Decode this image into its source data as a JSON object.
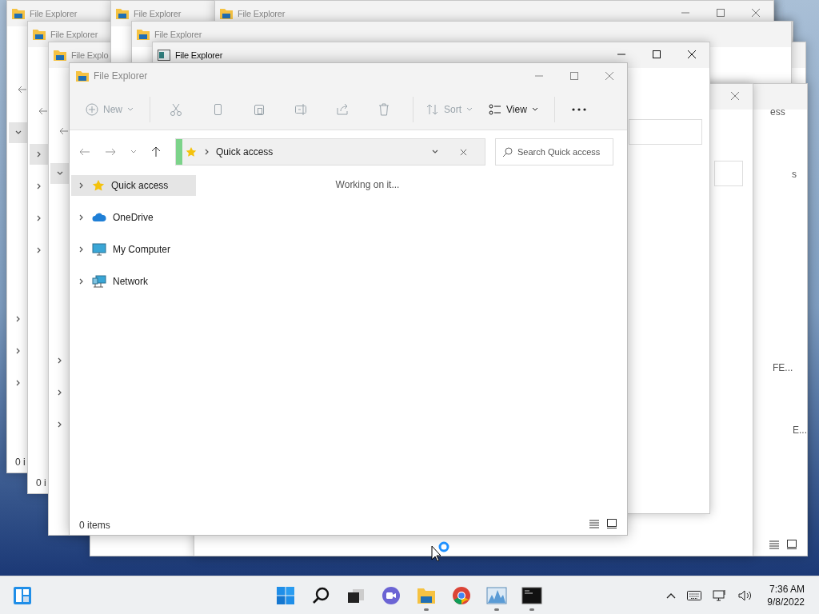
{
  "windows": [
    {
      "title": "File Explorer",
      "kind": "folder",
      "status": "0 i"
    },
    {
      "title": "File Explorer",
      "kind": "folder",
      "status": "0 i"
    },
    {
      "title": "File Explo",
      "kind": "folder"
    },
    {
      "title": "File Explorer",
      "kind": "folder"
    },
    {
      "title": "File Explorer",
      "kind": "folder"
    },
    {
      "title": "File Explorer",
      "kind": "folder"
    },
    {
      "kind": "blank",
      "fragments": [
        "ess",
        "s",
        "FE...",
        "E..."
      ]
    },
    {
      "kind": "blank"
    },
    {
      "title": "File Explorer",
      "kind": "app"
    }
  ],
  "front": {
    "title": "File Explorer",
    "toolbar": [
      {
        "label": "New",
        "disabled": true
      },
      {
        "disabled": true
      },
      {
        "disabled": true
      },
      {
        "disabled": true
      },
      {
        "disabled": true
      },
      {
        "disabled": true
      },
      {
        "disabled": true
      },
      {
        "label": "Sort",
        "disabled": true
      },
      {
        "label": "View",
        "disabled": false
      }
    ],
    "address": {
      "path": "Quick access"
    },
    "search": {
      "placeholder": "Search Quick access"
    },
    "tree": [
      {
        "label": "Quick access",
        "selected": true
      },
      {
        "label": "OneDrive",
        "selected": false
      },
      {
        "label": "My Computer",
        "selected": false
      },
      {
        "label": "Network",
        "selected": false
      }
    ],
    "message": "Working on it...",
    "status": "0 items"
  },
  "taskbar": {
    "apps": [
      {
        "running": false
      },
      {
        "running": false
      },
      {
        "running": false
      },
      {
        "running": false
      },
      {
        "running": true
      },
      {
        "running": false
      },
      {
        "running": true
      },
      {
        "running": true
      }
    ],
    "clock": {
      "time": "7:36 AM",
      "date": "9/8/2022"
    }
  }
}
